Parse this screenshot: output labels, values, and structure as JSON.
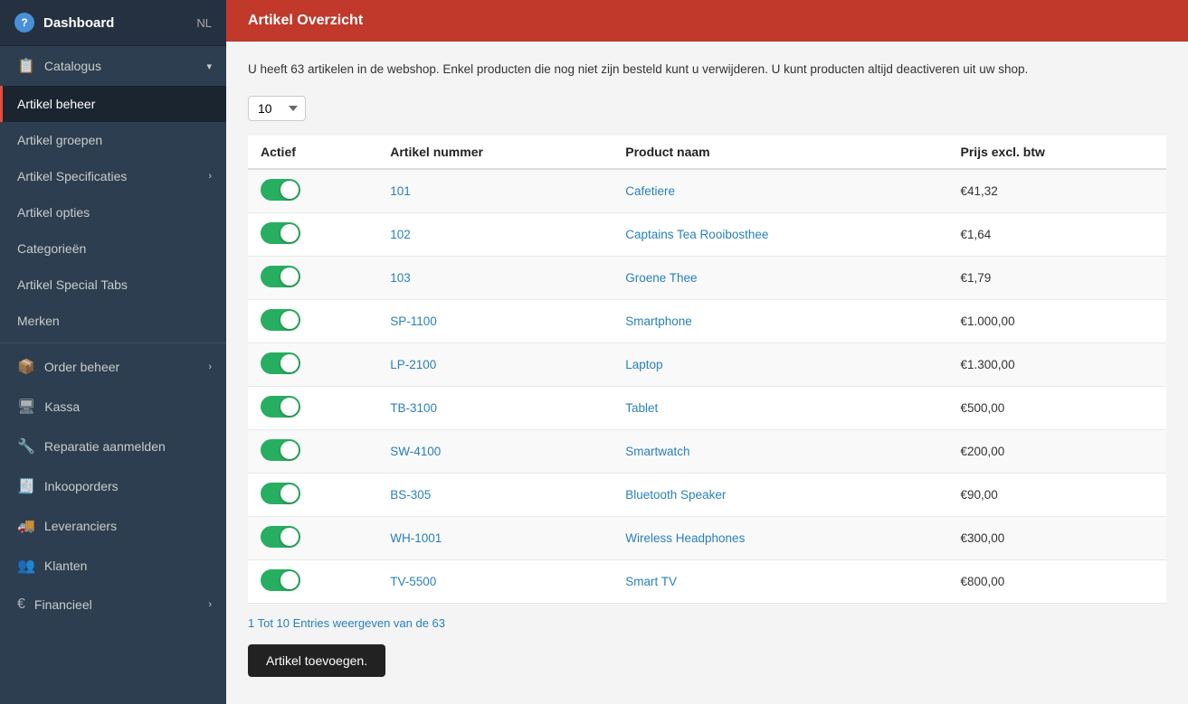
{
  "sidebar": {
    "dashboard_label": "Dashboard",
    "lang_label": "NL",
    "items": [
      {
        "id": "catalogus",
        "label": "Catalogus",
        "icon": "📋",
        "has_chevron": true,
        "active": false
      },
      {
        "id": "artikel-beheer",
        "label": "Artikel beheer",
        "icon": "",
        "has_chevron": false,
        "active": true
      },
      {
        "id": "artikel-groepen",
        "label": "Artikel groepen",
        "icon": "",
        "has_chevron": false,
        "active": false
      },
      {
        "id": "artikel-specificaties",
        "label": "Artikel Specificaties",
        "icon": "",
        "has_chevron": false,
        "active": false
      },
      {
        "id": "artikel-opties",
        "label": "Artikel opties",
        "icon": "",
        "has_chevron": false,
        "active": false
      },
      {
        "id": "categorieen",
        "label": "Categorieën",
        "icon": "",
        "has_chevron": false,
        "active": false
      },
      {
        "id": "artikel-special-tabs",
        "label": "Artikel Special Tabs",
        "icon": "",
        "has_chevron": false,
        "active": false
      },
      {
        "id": "merken",
        "label": "Merken",
        "icon": "",
        "has_chevron": false,
        "active": false
      },
      {
        "id": "order-beheer",
        "label": "Order beheer",
        "icon": "📦",
        "has_chevron": true,
        "active": false
      },
      {
        "id": "kassa",
        "label": "Kassa",
        "icon": "🖥",
        "has_chevron": false,
        "active": false
      },
      {
        "id": "reparatie-aanmelden",
        "label": "Reparatie aanmelden",
        "icon": "🔧",
        "has_chevron": false,
        "active": false
      },
      {
        "id": "inkooporders",
        "label": "Inkooporders",
        "icon": "🧾",
        "has_chevron": false,
        "active": false
      },
      {
        "id": "leveranciers",
        "label": "Leveranciers",
        "icon": "🚚",
        "has_chevron": false,
        "active": false
      },
      {
        "id": "klanten",
        "label": "Klanten",
        "icon": "👥",
        "has_chevron": false,
        "active": false
      },
      {
        "id": "financieel",
        "label": "Financieel",
        "icon": "€",
        "has_chevron": true,
        "active": false
      }
    ]
  },
  "page": {
    "title": "Artikel Overzicht",
    "info_text": "U heeft 63 artikelen in de webshop. Enkel producten die nog niet zijn besteld kunt u verwijderen. U kunt producten altijd deactiveren uit uw shop.",
    "per_page_value": "10",
    "pagination_text": "1 Tot 10 Entries weergeven van de 63",
    "add_button_label": "Artikel toevoegen."
  },
  "table": {
    "columns": [
      "Actief",
      "Artikel nummer",
      "Product naam",
      "Prijs excl. btw"
    ],
    "rows": [
      {
        "active": true,
        "artikel_nr": "101",
        "product_naam": "Cafetiere",
        "prijs": "€41,32"
      },
      {
        "active": true,
        "artikel_nr": "102",
        "product_naam": "Captains Tea Rooibosthee",
        "prijs": "€1,64"
      },
      {
        "active": true,
        "artikel_nr": "103",
        "product_naam": "Groene Thee",
        "prijs": "€1,79"
      },
      {
        "active": true,
        "artikel_nr": "SP-1100",
        "product_naam": "Smartphone",
        "prijs": "€1.000,00"
      },
      {
        "active": true,
        "artikel_nr": "LP-2100",
        "product_naam": "Laptop",
        "prijs": "€1.300,00"
      },
      {
        "active": true,
        "artikel_nr": "TB-3100",
        "product_naam": "Tablet",
        "prijs": "€500,00"
      },
      {
        "active": true,
        "artikel_nr": "SW-4100",
        "product_naam": "Smartwatch",
        "prijs": "€200,00"
      },
      {
        "active": true,
        "artikel_nr": "BS-305",
        "product_naam": "Bluetooth Speaker",
        "prijs": "€90,00"
      },
      {
        "active": true,
        "artikel_nr": "WH-1001",
        "product_naam": "Wireless Headphones",
        "prijs": "€300,00"
      },
      {
        "active": true,
        "artikel_nr": "TV-5500",
        "product_naam": "Smart TV",
        "prijs": "€800,00"
      }
    ]
  }
}
